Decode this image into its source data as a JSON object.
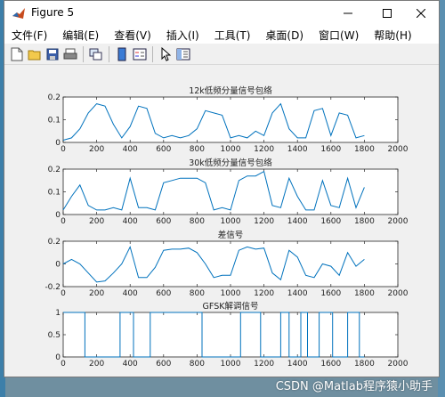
{
  "window": {
    "title": "Figure 5",
    "controls": {
      "minimize": "minimize",
      "maximize": "maximize",
      "close": "close"
    }
  },
  "menu": {
    "items": [
      "文件(F)",
      "编辑(E)",
      "查看(V)",
      "插入(I)",
      "工具(T)",
      "桌面(D)",
      "窗口(W)",
      "帮助(H)"
    ]
  },
  "toolbar": {
    "buttons": [
      "new-figure-icon",
      "open-file-icon",
      "save-icon",
      "print-icon",
      "link-plot-icon",
      "insert-colorbar-icon",
      "insert-legend-icon",
      "edit-plot-arrow-icon",
      "property-editor-icon"
    ]
  },
  "watermark": "CSDN @Matlab程序猿小助手",
  "chart_data": [
    {
      "type": "line",
      "title": "12k低频分量信号包络",
      "xlim": [
        0,
        2000
      ],
      "ylim": [
        0,
        0.2
      ],
      "xticks": [
        "0",
        "200",
        "400",
        "600",
        "800",
        "1000",
        "1200",
        "1400",
        "1600",
        "1800",
        "2000"
      ],
      "yticks": [
        "0",
        "0.1",
        "0.2"
      ],
      "x": [
        0,
        50,
        100,
        150,
        200,
        250,
        300,
        350,
        400,
        450,
        500,
        550,
        600,
        650,
        700,
        750,
        800,
        850,
        900,
        950,
        1000,
        1050,
        1100,
        1150,
        1200,
        1250,
        1300,
        1350,
        1400,
        1450,
        1500,
        1550,
        1600,
        1650,
        1700,
        1750,
        1800
      ],
      "y": [
        0.01,
        0.02,
        0.06,
        0.13,
        0.17,
        0.16,
        0.08,
        0.02,
        0.07,
        0.16,
        0.15,
        0.04,
        0.02,
        0.03,
        0.02,
        0.03,
        0.06,
        0.14,
        0.13,
        0.12,
        0.02,
        0.03,
        0.02,
        0.05,
        0.03,
        0.13,
        0.17,
        0.06,
        0.02,
        0.02,
        0.14,
        0.15,
        0.03,
        0.13,
        0.12,
        0.02,
        0.03
      ],
      "grid": false
    },
    {
      "type": "line",
      "title": "30k低频分量信号包络",
      "xlim": [
        0,
        2000
      ],
      "ylim": [
        0,
        0.2
      ],
      "xticks": [
        "0",
        "200",
        "400",
        "600",
        "800",
        "1000",
        "1200",
        "1400",
        "1600",
        "1800",
        "2000"
      ],
      "yticks": [
        "0",
        "0.1",
        "0.2"
      ],
      "x": [
        0,
        50,
        100,
        150,
        200,
        250,
        300,
        350,
        400,
        450,
        500,
        550,
        600,
        650,
        700,
        750,
        800,
        850,
        900,
        950,
        1000,
        1050,
        1100,
        1150,
        1200,
        1250,
        1300,
        1350,
        1400,
        1450,
        1500,
        1550,
        1600,
        1650,
        1700,
        1750,
        1800
      ],
      "y": [
        0.02,
        0.08,
        0.13,
        0.04,
        0.02,
        0.02,
        0.03,
        0.02,
        0.16,
        0.03,
        0.03,
        0.02,
        0.14,
        0.15,
        0.16,
        0.16,
        0.16,
        0.14,
        0.02,
        0.03,
        0.02,
        0.15,
        0.17,
        0.17,
        0.19,
        0.04,
        0.03,
        0.16,
        0.08,
        0.02,
        0.02,
        0.15,
        0.04,
        0.03,
        0.16,
        0.03,
        0.12
      ],
      "grid": false
    },
    {
      "type": "line",
      "title": "差信号",
      "xlim": [
        0,
        2000
      ],
      "ylim": [
        -0.2,
        0.2
      ],
      "xticks": [
        "0",
        "200",
        "400",
        "600",
        "800",
        "1000",
        "1200",
        "1400",
        "1600",
        "1800",
        "2000"
      ],
      "yticks": [
        "-0.2",
        "0",
        "0.2"
      ],
      "x": [
        0,
        50,
        100,
        150,
        200,
        250,
        300,
        350,
        400,
        450,
        500,
        550,
        600,
        650,
        700,
        750,
        800,
        850,
        900,
        950,
        1000,
        1050,
        1100,
        1150,
        1200,
        1250,
        1300,
        1350,
        1400,
        1450,
        1500,
        1550,
        1600,
        1650,
        1700,
        1750,
        1800
      ],
      "y": [
        0.0,
        0.04,
        0.0,
        -0.08,
        -0.16,
        -0.15,
        -0.08,
        0.0,
        0.15,
        -0.12,
        -0.12,
        -0.03,
        0.12,
        0.13,
        0.13,
        0.14,
        0.1,
        0.0,
        -0.12,
        -0.1,
        -0.1,
        0.12,
        0.15,
        0.13,
        0.14,
        -0.08,
        -0.14,
        0.12,
        0.06,
        -0.1,
        -0.12,
        0.0,
        -0.02,
        -0.1,
        0.1,
        -0.02,
        0.04
      ],
      "grid": false
    },
    {
      "type": "line",
      "title": "GFSK解调信号",
      "xlim": [
        0,
        2000
      ],
      "ylim": [
        0,
        1
      ],
      "xticks": [
        "0",
        "200",
        "400",
        "600",
        "800",
        "1000",
        "1200",
        "1400",
        "1600",
        "1800",
        "2000"
      ],
      "yticks": [
        "0",
        "0.5",
        "1"
      ],
      "transitions": [
        0,
        130,
        340,
        420,
        520,
        830,
        1060,
        1180,
        1300,
        1350,
        1420,
        1460,
        1530,
        1610,
        1700,
        1770,
        1800
      ],
      "start_level": 1,
      "grid": false
    }
  ],
  "colors": {
    "line": "#0072bd",
    "axes": "#262626",
    "window_bg": "#f0f0f0"
  }
}
